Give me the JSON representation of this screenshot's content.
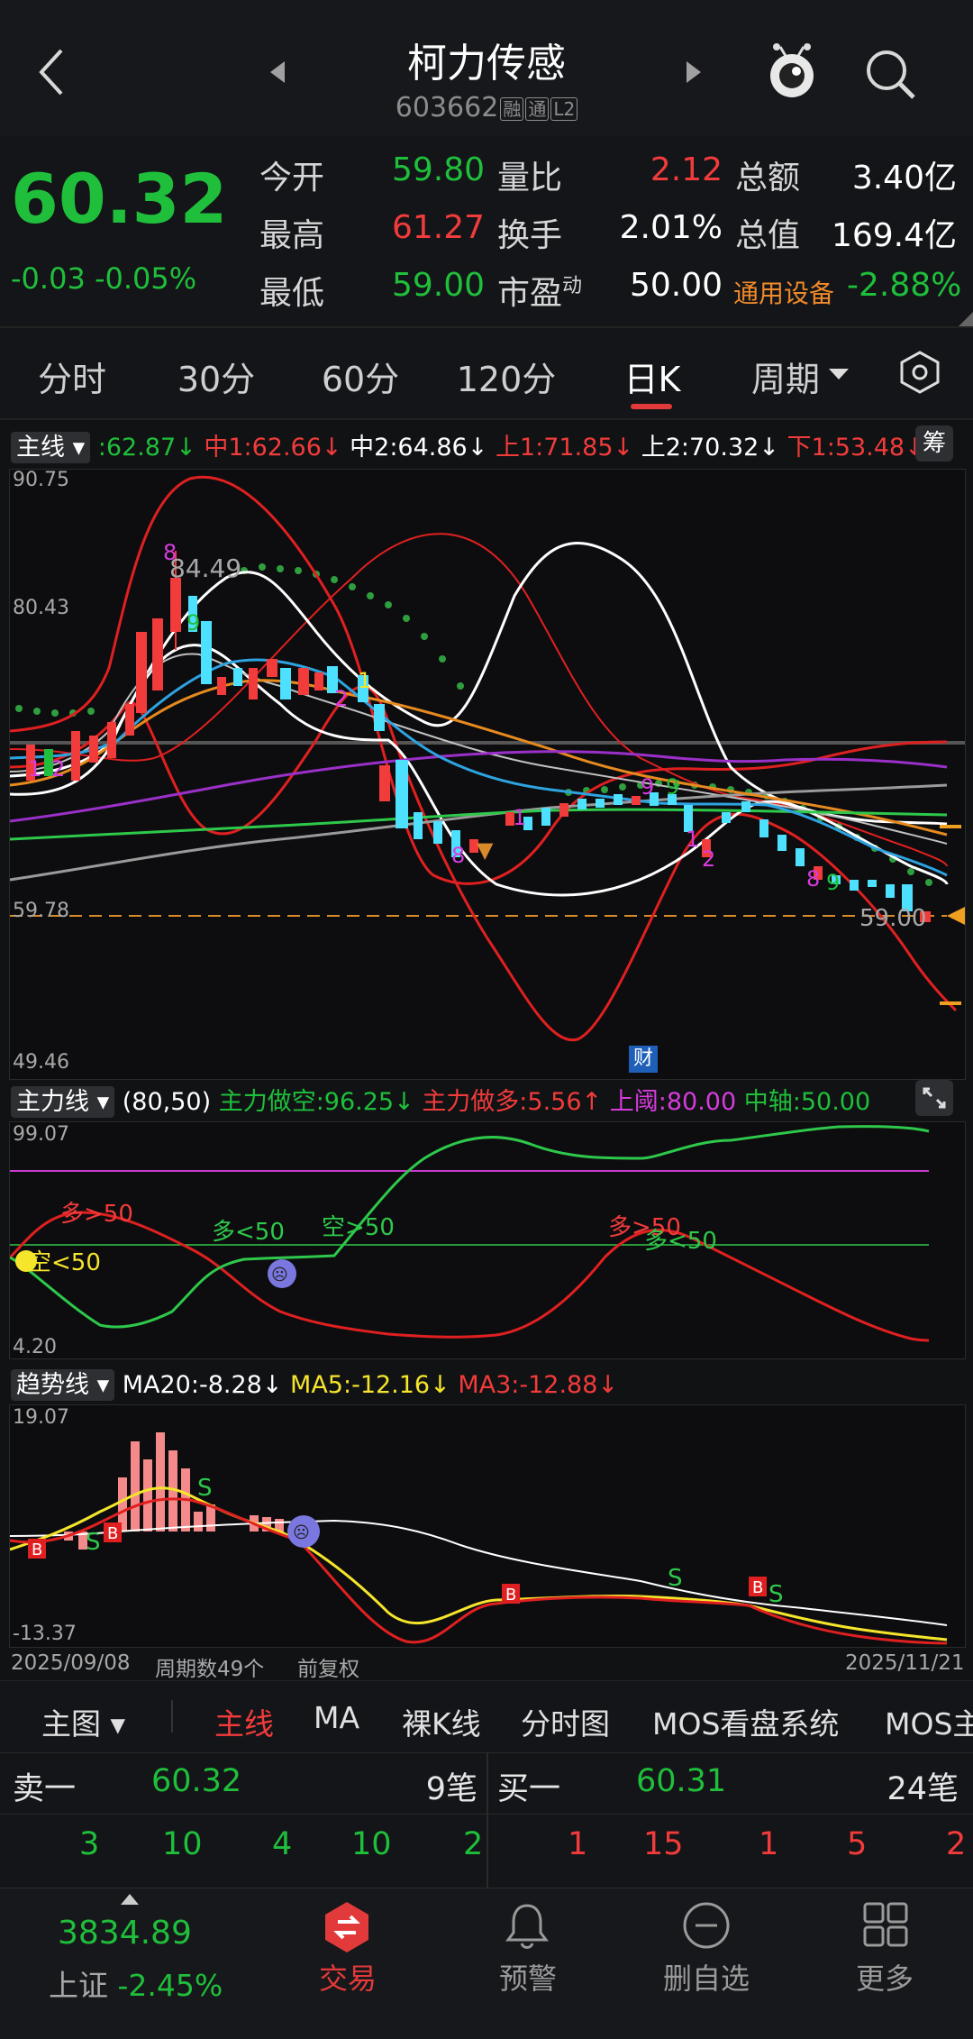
{
  "header": {
    "title": "柯力传感",
    "code": "603662",
    "tags": [
      "融",
      "通",
      "L2"
    ]
  },
  "quote": {
    "price": "60.32",
    "change": "-0.03",
    "change_pct": "-0.05%",
    "rows": [
      {
        "l1": "今开",
        "v1": "59.80",
        "l2": "量比",
        "v2": "2.12",
        "l3": "总额",
        "v3": "3.40亿"
      },
      {
        "l1": "最高",
        "v1": "61.27",
        "l2": "换手",
        "v2": "2.01%",
        "l3": "总值",
        "v3": "169.4亿"
      },
      {
        "l1": "最低",
        "v1": "59.00",
        "l2": "市盈",
        "v2": "50.00",
        "l3": "通用设备",
        "v3": "-2.88%"
      }
    ],
    "pe_sup": "动"
  },
  "tabs": [
    "分时",
    "30分",
    "60分",
    "120分",
    "日K",
    "周期"
  ],
  "main_indicator": {
    "name": "主线",
    "items": [
      {
        "text": ":62.87↓",
        "color": "#1fbf3b"
      },
      {
        "text": "中1:62.66↓",
        "color": "#f23b3b"
      },
      {
        "text": "中2:64.86↓",
        "color": "#ffffff"
      },
      {
        "text": "上1:71.85↓",
        "color": "#f23b3b"
      },
      {
        "text": "上2:70.32↓",
        "color": "#ffffff"
      },
      {
        "text": "下1:53.48↓",
        "color": "#f23b3b"
      }
    ],
    "chip": "筹",
    "y_labels": [
      "90.75",
      "80.43",
      "59.78",
      "49.46"
    ],
    "price_line_label": "59.00",
    "annot_high": "84.49",
    "finance_badge": "财"
  },
  "sub1": {
    "name": "主力线",
    "params": "(80,50)",
    "items": [
      {
        "text": "主力做空:96.25↓",
        "color": "#1fbf3b"
      },
      {
        "text": "主力做多:5.56↑",
        "color": "#f23b3b"
      },
      {
        "text": "上阈:80.00",
        "color": "#d63cdc"
      },
      {
        "text": "中轴:50.00",
        "color": "#1fbf3b"
      }
    ],
    "y_labels": [
      "99.07",
      "4.20"
    ],
    "annots": [
      "多>50",
      "空<50",
      "多<50",
      "空>50",
      "多>50",
      "多<50"
    ]
  },
  "sub2": {
    "name": "趋势线",
    "items": [
      {
        "text": "MA20:-8.28↓",
        "color": "#ffffff"
      },
      {
        "text": "MA5:-12.16↓",
        "color": "#f5e52b"
      },
      {
        "text": "MA3:-12.88↓",
        "color": "#f23b3b"
      }
    ],
    "y_labels": [
      "19.07",
      "-13.37"
    ]
  },
  "date_bar": {
    "start": "2025/09/08",
    "period": "周期数49个",
    "adjust": "前复权",
    "end": "2025/11/21"
  },
  "selector": [
    "主图",
    "主线",
    "MA",
    "裸K线",
    "分时图",
    "MOS看盘系统",
    "MOS主"
  ],
  "orderbook": {
    "sell_label": "卖一",
    "sell_price": "60.32",
    "sell_count": "9笔",
    "buy_label": "买一",
    "buy_price": "60.31",
    "buy_count": "24笔",
    "sell_queue": [
      "3",
      "10",
      "4",
      "10",
      "2"
    ],
    "buy_queue": [
      "1",
      "15",
      "1",
      "5",
      "2"
    ]
  },
  "nav": {
    "index_value": "3834.89",
    "index_name": "上证",
    "index_change": "-2.45%",
    "items": [
      "交易",
      "预警",
      "删自选",
      "更多"
    ]
  },
  "colors": {
    "up": "#f23b3b",
    "down": "#1fbf3b",
    "accent": "#e23a3a"
  }
}
